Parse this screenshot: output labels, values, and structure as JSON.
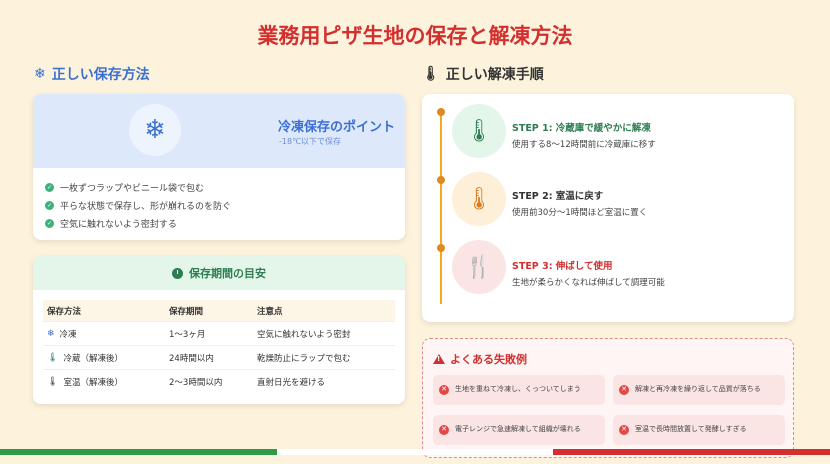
{
  "title": "業務用ピザ生地の保存と解凍方法",
  "storage": {
    "heading": "正しい保存方法",
    "freeze_title": "冷凍保存のポイント",
    "freeze_sub": "-18℃以下で保存",
    "points": [
      "一枚ずつラップやビニール袋で包む",
      "平らな状態で保存し、形が崩れるのを防ぐ",
      "空気に触れないよう密封する"
    ]
  },
  "period": {
    "heading": "保存期間の目安",
    "columns": [
      "保存方法",
      "保存期間",
      "注意点"
    ],
    "rows": [
      {
        "icon": "❄",
        "method": "冷凍",
        "duration": "1〜3ヶ月",
        "note": "空気に触れないよう密封"
      },
      {
        "icon": "🌡",
        "method": "冷蔵（解凍後）",
        "duration": "24時間以内",
        "note": "乾燥防止にラップで包む"
      },
      {
        "icon": "🌡",
        "method": "室温（解凍後）",
        "duration": "2〜3時間以内",
        "note": "直射日光を避ける"
      }
    ]
  },
  "thaw": {
    "heading": "正しい解凍手順",
    "steps": [
      {
        "title": "STEP 1: 冷蔵庫で緩やかに解凍",
        "desc": "使用する8〜12時間前に冷蔵庫に移す",
        "color": "#2e7d52",
        "bg": "#e4f6ea"
      },
      {
        "title": "STEP 2: 室温に戻す",
        "desc": "使用前30分〜1時間ほど室温に置く",
        "color": "#333333",
        "bg": "#fdefd8"
      },
      {
        "title": "STEP 3: 伸ばして使用",
        "desc": "生地が柔らかくなれば伸ばして調理可能",
        "color": "#d32f2f",
        "bg": "#fbe4e4"
      }
    ]
  },
  "fails": {
    "heading": "よくある失敗例",
    "items": [
      "生地を重ねて冷凍し、くっついてしまう",
      "解凍と再冷凍を繰り返して品質が落ちる",
      "電子レンジで急速解凍して組織が壊れる",
      "室温で長時間放置して発酵しすぎる"
    ]
  },
  "colors": {
    "accent_red": "#d32f2f",
    "accent_blue": "#3b6fd1",
    "accent_green": "#2e7d52",
    "flag": [
      "#2e9a4a",
      "#ffffff",
      "#d32f2f"
    ]
  }
}
